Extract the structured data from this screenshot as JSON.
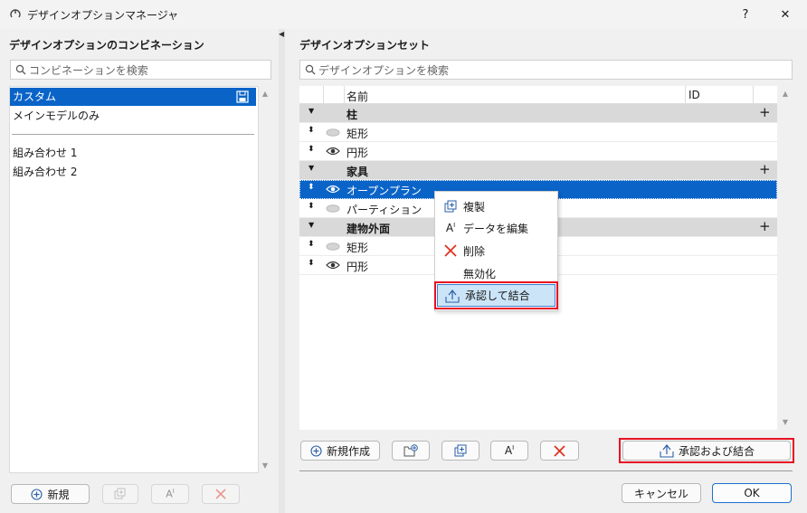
{
  "window": {
    "title": "デザインオプションマネージャ",
    "help": "?",
    "close": "✕"
  },
  "left": {
    "title": "デザインオプションのコンビネーション",
    "search_placeholder": "コンビネーションを検索",
    "items": [
      "カスタム",
      "メインモデルのみ",
      "組み合わせ 1",
      "組み合わせ 2"
    ],
    "new_button": "新規"
  },
  "right": {
    "title": "デザインオプションセット",
    "search_placeholder": "デザインオプションを検索",
    "columns": {
      "name": "名前",
      "id": "ID"
    },
    "rows": [
      {
        "type": "group",
        "label": "柱"
      },
      {
        "type": "item",
        "label": "矩形",
        "visible": false
      },
      {
        "type": "item",
        "label": "円形",
        "visible": true
      },
      {
        "type": "group",
        "label": "家具"
      },
      {
        "type": "item",
        "label": "オープンプラン",
        "visible": true,
        "selected": true
      },
      {
        "type": "item",
        "label": "パーティション",
        "visible": false
      },
      {
        "type": "group",
        "label": "建物外面"
      },
      {
        "type": "item",
        "label": "矩形",
        "visible": false
      },
      {
        "type": "item",
        "label": "円形",
        "visible": true
      }
    ],
    "new_button": "新規作成",
    "approve_merge_button": "承認および結合"
  },
  "context_menu": [
    "複製",
    "データを編集",
    "削除",
    "無効化",
    "承認して結合"
  ],
  "footer": {
    "cancel": "キャンセル",
    "ok": "OK"
  },
  "colors": {
    "selection": "#0a64c8",
    "highlight": "#e81123",
    "delete": "#e0321e"
  }
}
